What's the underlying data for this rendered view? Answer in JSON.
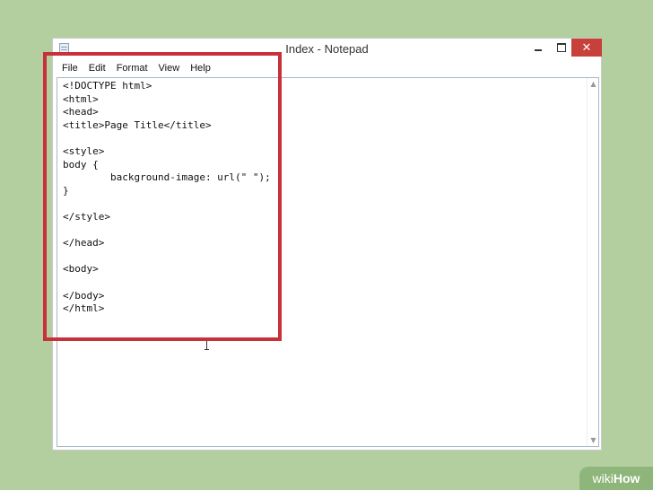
{
  "window": {
    "title": "Index - Notepad",
    "close_glyph": "✕"
  },
  "menu": [
    "File",
    "Edit",
    "Format",
    "View",
    "Help"
  ],
  "editor": {
    "content": "<!DOCTYPE html>\n<html>\n<head>\n<title>Page Title</title>\n\n<style>\nbody {\n        background-image: url(\" \");\n}\n\n</style>\n\n</head>\n\n<body>\n\n</body>\n</html>"
  },
  "scrollbar": {
    "up_glyph": "▲",
    "down_glyph": "▼"
  },
  "watermark": {
    "prefix": "wiki",
    "suffix": "How"
  },
  "colors": {
    "background": "#b3cfa0",
    "highlight": "#c8303c",
    "close_button": "#c7403a"
  }
}
